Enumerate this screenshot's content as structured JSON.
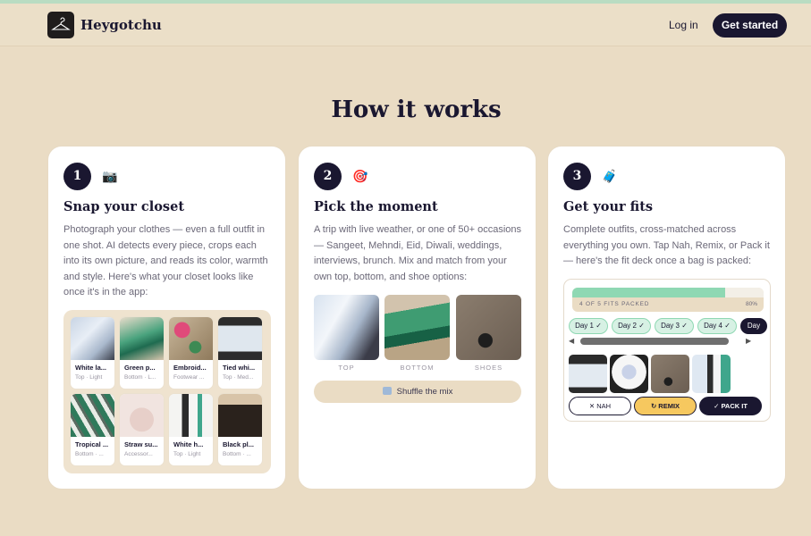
{
  "nav": {
    "brand": "Heygotchu",
    "login": "Log in",
    "cta": "Get started"
  },
  "heading": "How it works",
  "cards": [
    {
      "num": "1",
      "emoji": "📷",
      "title": "Snap your closet",
      "desc": "Photograph your clothes — even a full outfit in one shot. AI detects every piece, crops each into its own picture, and reads its color, warmth and style. Here's what your closet looks like once it's in the app:",
      "closet": [
        {
          "name": "White la...",
          "tag": "Top · Light"
        },
        {
          "name": "Green p...",
          "tag": "Bottom · L..."
        },
        {
          "name": "Embroid...",
          "tag": "Footwear ..."
        },
        {
          "name": "Tied whi...",
          "tag": "Top · Med..."
        },
        {
          "name": "Tropical ...",
          "tag": "Bottom · ..."
        },
        {
          "name": "Straw su...",
          "tag": "Accessor..."
        },
        {
          "name": "White h...",
          "tag": "Top · Light"
        },
        {
          "name": "Black pl...",
          "tag": "Bottom · ..."
        }
      ]
    },
    {
      "num": "2",
      "emoji": "🎯",
      "title": "Pick the moment",
      "desc": "A trip with live weather, or one of 50+ occasions — Sangeet, Mehndi, Eid, Diwali, weddings, interviews, brunch. Mix and match from your own top, bottom, and shoe options:",
      "labels": [
        "TOP",
        "BOTTOM",
        "SHOES"
      ],
      "shuffle": "Shuffle the mix",
      "shuffle_icon": "🔀"
    },
    {
      "num": "3",
      "emoji": "🧳",
      "title": "Get your fits",
      "desc": "Complete outfits, cross-matched across everything you own. Tap Nah, Remix, or Pack it — here's the fit deck once a bag is packed:",
      "progress_label": "4 OF 5 FITS PACKED",
      "progress_pct": "80%",
      "progress_value": 0.8,
      "days": [
        "Day 1 ✓",
        "Day 2 ✓",
        "Day 3 ✓",
        "Day 4 ✓",
        "Day"
      ],
      "buttons": {
        "nah": "✕ NAH",
        "remix": "↻ REMIX",
        "pack": "✓ PACK IT"
      }
    }
  ],
  "colors": {
    "background": "#eadcc4",
    "ink": "#1a1730",
    "mint": "#8fd8b3",
    "gold": "#f6c85f"
  }
}
